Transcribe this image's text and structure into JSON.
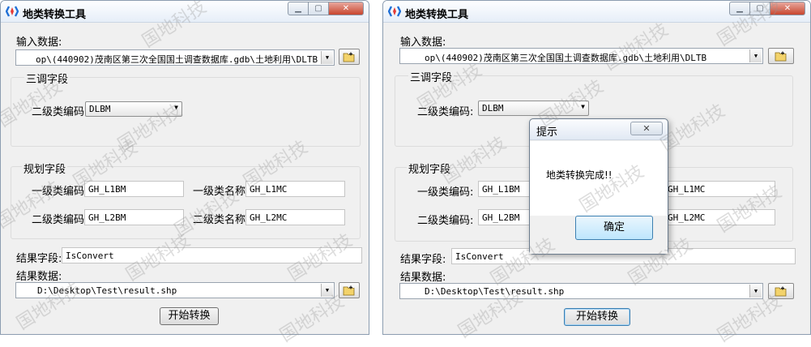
{
  "window": {
    "title": "地类转换工具",
    "input_label": "输入数据:",
    "input_value": "op\\(440902)茂南区第三次全国国土调查数据库.gdb\\土地利用\\DLTB",
    "sandiao_group": "三调字段",
    "erji_code_label": "二级类编码:",
    "erji_code_value": "DLBM",
    "guihua_group": "规划字段",
    "yiji_code_label": "一级类编码:",
    "yiji_code_value": "GH_L1BM",
    "yiji_name_label": "一级类名称:",
    "yiji_name_value": "GH_L1MC",
    "gh_erji_code_label": "二级类编码:",
    "gh_erji_code_value": "GH_L2BM",
    "gh_erji_name_label": "二级类名称:",
    "gh_erji_name_value": "GH_L2MC",
    "result_field_label": "结果字段:",
    "result_field_value": "IsConvert",
    "result_data_label": "结果数据:",
    "result_data_value": "D:\\Desktop\\Test\\result.shp",
    "start_button": "开始转换"
  },
  "dialog": {
    "title": "提示",
    "message": "地类转换完成!!",
    "ok_button": "确定"
  },
  "watermark_text": "国地科技",
  "colors": {
    "window_bg": "#f0f0f0",
    "focus_blue": "#3c7fb1",
    "close_red": "#c8462f"
  }
}
